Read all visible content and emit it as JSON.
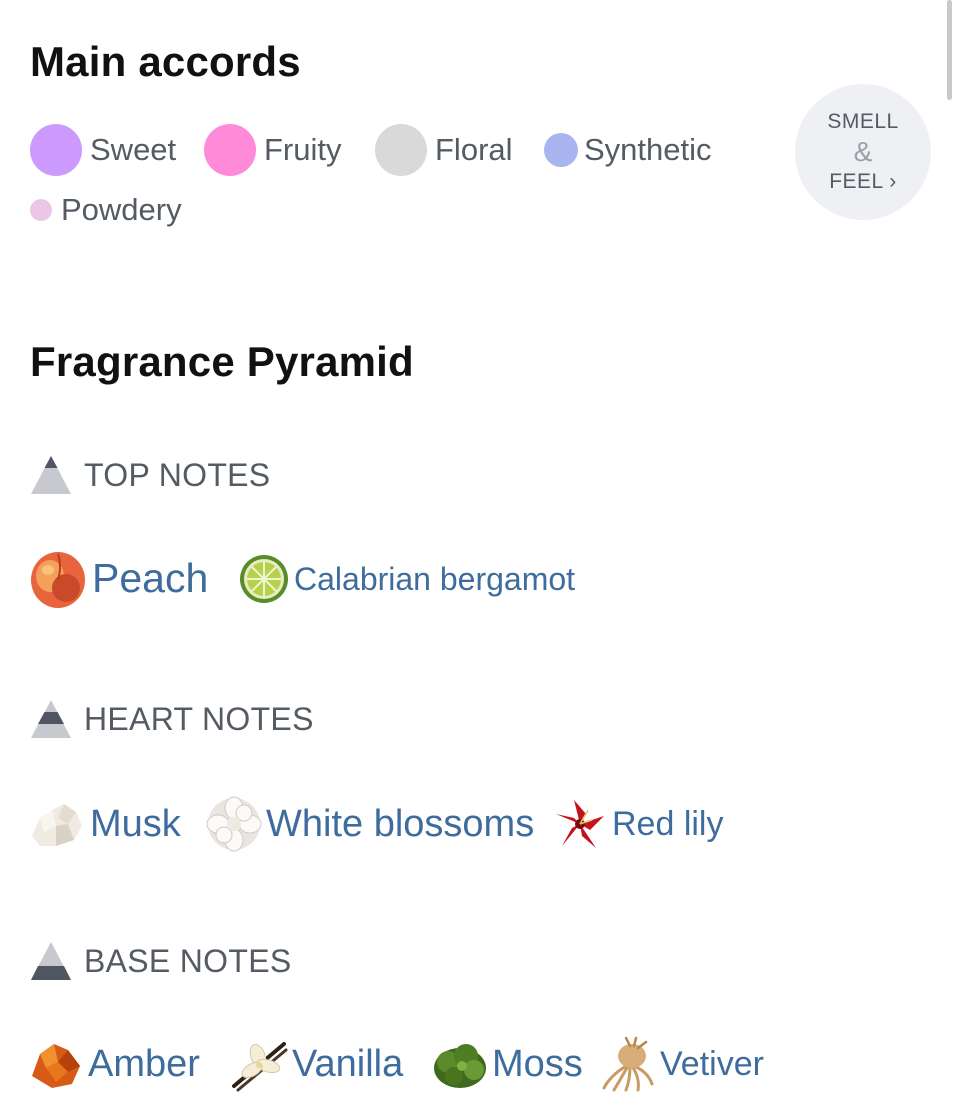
{
  "main_accords": {
    "title": "Main accords",
    "accords": [
      {
        "label": "Sweet",
        "color": "#cc99ff"
      },
      {
        "label": "Fruity",
        "color": "#ff8ad8"
      },
      {
        "label": "Floral",
        "color": "#d9d9d9"
      },
      {
        "label": "Synthetic",
        "color": "#a8b5f0"
      },
      {
        "label": "Powdery",
        "color": "#ebc6e6"
      }
    ],
    "smell_feel": {
      "line1": "SMELL",
      "amp": "&",
      "line2": "FEEL ›"
    }
  },
  "pyramid": {
    "title": "Fragrance Pyramid",
    "top": {
      "label": "TOP NOTES",
      "notes": [
        {
          "label": "Peach",
          "icon": "peach-icon"
        },
        {
          "label": "Calabrian bergamot",
          "icon": "bergamot-icon"
        }
      ]
    },
    "heart": {
      "label": "HEART NOTES",
      "notes": [
        {
          "label": "Musk",
          "icon": "musk-icon"
        },
        {
          "label": "White blossoms",
          "icon": "white-blossoms-icon"
        },
        {
          "label": "Red lily",
          "icon": "red-lily-icon"
        }
      ]
    },
    "base": {
      "label": "BASE NOTES",
      "notes": [
        {
          "label": "Amber",
          "icon": "amber-icon"
        },
        {
          "label": "Vanilla",
          "icon": "vanilla-icon"
        },
        {
          "label": "Moss",
          "icon": "moss-icon"
        },
        {
          "label": "Vetiver",
          "icon": "vetiver-icon"
        }
      ]
    }
  }
}
